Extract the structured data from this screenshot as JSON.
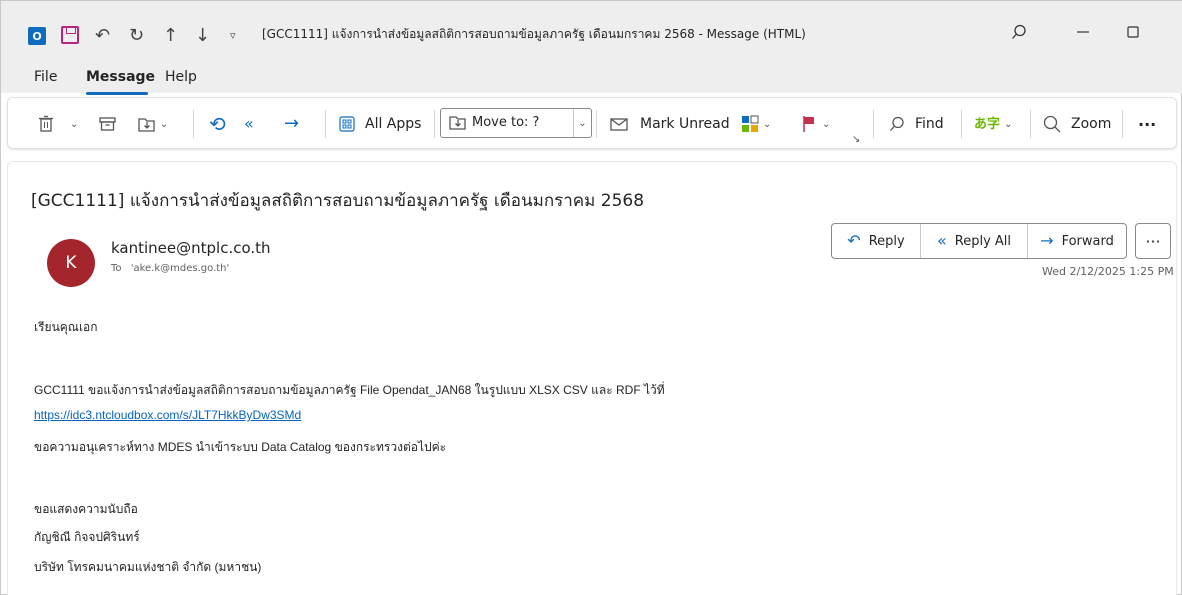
{
  "window": {
    "title": "[GCC1111] แจ้งการนำส่งข้อมูลสถิติการสอบถามข้อมูลภาครัฐ  เดือนมกราคม 2568  -  Message (HTML)",
    "logo_letter": "O"
  },
  "menu": {
    "items": [
      "File",
      "Message",
      "Help"
    ],
    "active": "Message"
  },
  "toolbar": {
    "all_apps": "All Apps",
    "move_to": "Move to: ?",
    "mark_unread": "Mark Unread",
    "find": "Find",
    "zoom": "Zoom",
    "more": "···"
  },
  "message": {
    "subject": "[GCC1111] แจ้งการนำส่งข้อมูลสถิติการสอบถามข้อมูลภาครัฐ  เดือนมกราคม 2568",
    "avatar_letter": "K",
    "avatar_color": "#a4262c",
    "sender": "kantinee@ntplc.co.th",
    "to_label": "To",
    "to_value": "'ake.k@mdes.go.th'",
    "date": "Wed 2/12/2025 1:25 PM",
    "actions": {
      "reply": "Reply",
      "reply_all": "Reply All",
      "forward": "Forward",
      "more": "···"
    },
    "body": {
      "greeting": "เรียนคุณเอก",
      "line1": "GCC1111 ขอแจ้งการนำส่งข้อมูลสถิติการสอบถามข้อมูลภาครัฐ  File Opendat_JAN68  ในรูปแบบ XLSX  CSV และ RDF ไว้ที่",
      "link": "https://idc3.ntcloudbox.com/s/JLT7HkkByDw3SMd",
      "line3": "ขอความอนุเคราะห์ทาง MDES นำเข้าระบบ Data Catalog  ของกระทรวงต่อไปค่ะ",
      "closing": "ขอแสดงความนับถือ",
      "signer": "กัญชิณี กิจจปศิรินทร์",
      "company": "บริษัท โทรคมนาคมแห่งชาติ จำกัด (มหาชน)"
    }
  },
  "colors": {
    "accent": "#0f6cbd",
    "titlebar_bg": "#eeeeee",
    "link": "#0563c1"
  }
}
